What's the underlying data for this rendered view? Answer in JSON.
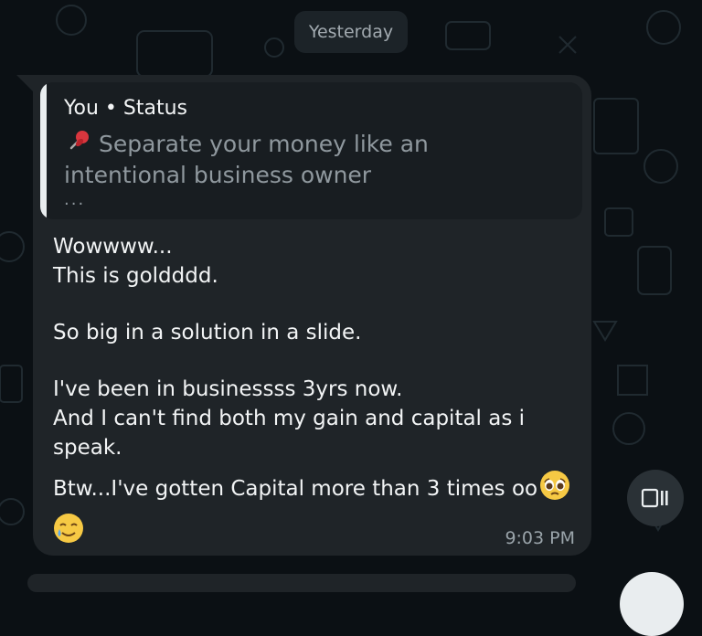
{
  "date_separator": "Yesterday",
  "message": {
    "quoted": {
      "author": "You • Status",
      "emoji_name": "pushpin",
      "text": "Separate your money like an intentional business owner",
      "ellipsis": "..."
    },
    "lines": [
      "Wowwww...",
      "This is goldddd.",
      "So big in a solution in a slide.",
      "I've been in businessss 3yrs now.",
      "And I can't find both my gain and capital as i speak.",
      "Btw...I've gotten Capital more than 3 times oo"
    ],
    "emoji_after_last_line": "pleading-face",
    "trailing_emoji": "smiling-face-with-tear",
    "time": "9:03 PM"
  },
  "floating_button": {
    "icon": "video-pause-icon"
  },
  "colors": {
    "background": "#0b1014",
    "bubble": "#1f2428",
    "quote_bg": "#181d21",
    "text": "#f2f4f5",
    "muted": "#8f989e"
  }
}
